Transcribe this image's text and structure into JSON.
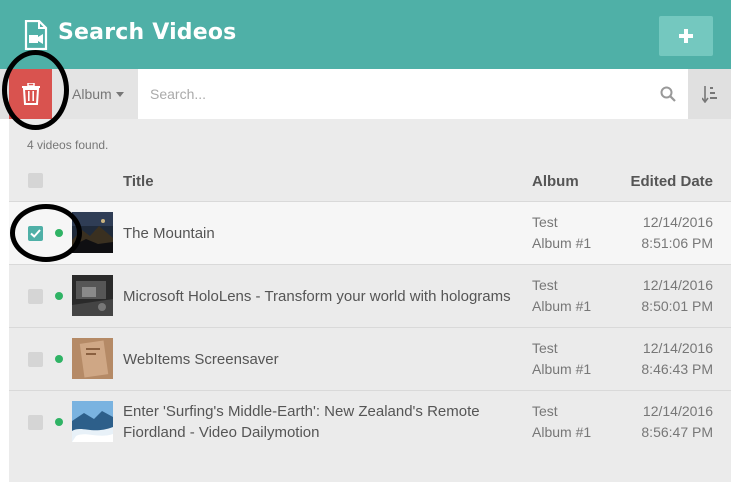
{
  "header": {
    "title": "Search Videos",
    "add_icon": "plus-icon",
    "title_icon": "video-file-icon",
    "bg_color": "#4fb0a7"
  },
  "toolbar": {
    "delete_icon": "trash-icon",
    "album_filter_label": "Album",
    "search_placeholder": "Search...",
    "search_value": "",
    "sort_icon": "sort-icon"
  },
  "results": {
    "count_text": "4 videos found."
  },
  "table": {
    "columns": {
      "title": "Title",
      "album": "Album",
      "date": "Edited Date"
    },
    "rows": [
      {
        "checked": true,
        "title_line1": "The Mountain",
        "title_line2": "",
        "album_line1": "Test",
        "album_line2": "Album #1",
        "date": "12/14/2016",
        "time": "8:51:06 PM"
      },
      {
        "checked": false,
        "title_line1": "Microsoft HoloLens - Transform your world with holograms",
        "title_line2": "",
        "album_line1": "Test",
        "album_line2": "Album #1",
        "date": "12/14/2016",
        "time": "8:50:01 PM"
      },
      {
        "checked": false,
        "title_line1": "WebItems Screensaver",
        "title_line2": "",
        "album_line1": "Test",
        "album_line2": "Album #1",
        "date": "12/14/2016",
        "time": "8:46:43 PM"
      },
      {
        "checked": false,
        "title_line1": "Enter 'Surfing's Middle-Earth': New Zealand's Remote",
        "title_line2": "Fiordland - Video Dailymotion",
        "album_line1": "Test",
        "album_line2": "Album #1",
        "date": "12/14/2016",
        "time": "8:56:47 PM"
      }
    ]
  }
}
